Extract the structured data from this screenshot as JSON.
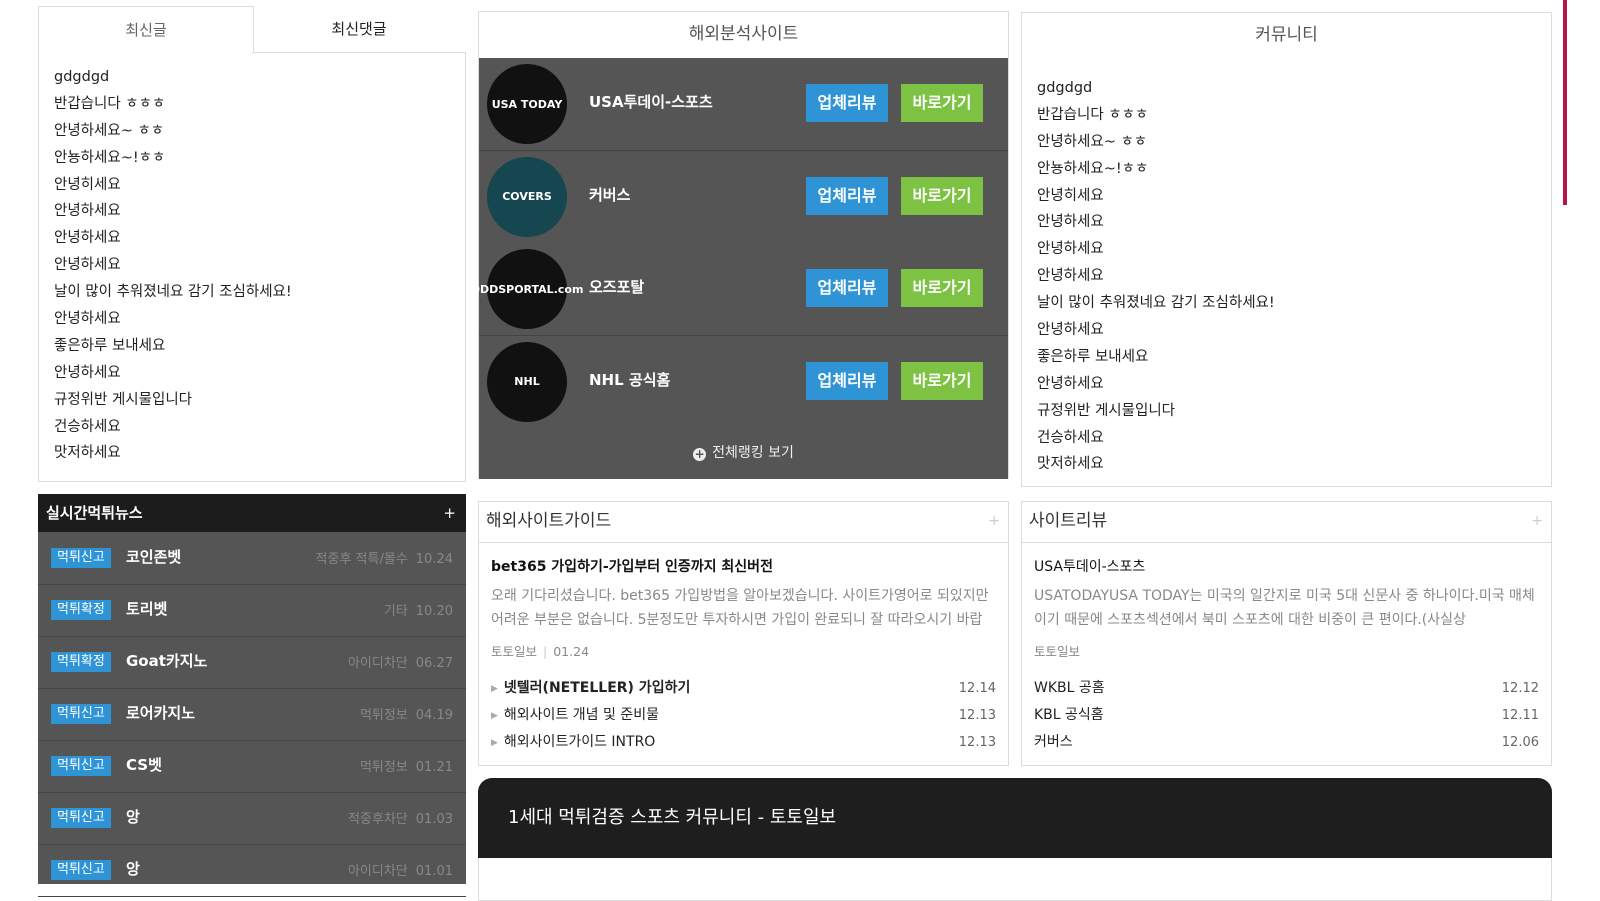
{
  "latest_tabs": {
    "tab_posts": "최신글",
    "tab_comments": "최신댓글"
  },
  "latest_posts": [
    "gdgdgd",
    "반갑습니다 ㅎㅎㅎ",
    "안녕하세요~ ㅎㅎ",
    "안뇽하세요~!ㅎㅎ",
    "안녕히세요",
    "안녕하세요",
    "안녕하세요",
    "안녕하세요",
    "날이 많이 추워졌네요 감기 조심하세요!",
    "안녕하세요",
    "좋은하루 보내세요",
    "안녕하세요",
    "규정위반 게시물입니다",
    "건승하세요",
    "맛저하세요"
  ],
  "analysis": {
    "title": "해외분석사이트",
    "sites": [
      {
        "name": "USA투데이-스포츠",
        "logo_text": "USA TODAY",
        "logo_color": "#111111",
        "review": "업체리뷰",
        "go": "바로가기"
      },
      {
        "name": "커버스",
        "logo_text": "COVERS",
        "logo_color": "#16464f",
        "review": "업체리뷰",
        "go": "바로가기"
      },
      {
        "name": "오즈포탈",
        "logo_text": "ODDSPORTAL.com",
        "logo_color": "#111111",
        "review": "업체리뷰",
        "go": "바로가기"
      },
      {
        "name": "NHL 공식홈",
        "logo_text": "NHL",
        "logo_color": "#111111",
        "review": "업체리뷰",
        "go": "바로가기"
      }
    ],
    "all_ranking": "전체랭킹 보기"
  },
  "community": {
    "title": "커뮤니티",
    "posts": [
      "gdgdgd",
      "반갑습니다 ㅎㅎㅎ",
      "안녕하세요~ ㅎㅎ",
      "안뇽하세요~!ㅎㅎ",
      "안녕히세요",
      "안녕하세요",
      "안녕하세요",
      "안녕하세요",
      "날이 많이 추워졌네요 감기 조심하세요!",
      "안녕하세요",
      "좋은하루 보내세요",
      "안녕하세요",
      "규정위반 게시물입니다",
      "건승하세요",
      "맛저하세요"
    ]
  },
  "news": {
    "title": "실시간먹튀뉴스",
    "plus": "+",
    "items": [
      {
        "badge": "먹튀신고",
        "title": "코인존벳",
        "category": "적중후 적특/몰수",
        "date": "10.24"
      },
      {
        "badge": "먹튀확정",
        "title": "토리벳",
        "category": "기타",
        "date": "10.20"
      },
      {
        "badge": "먹튀확정",
        "title": "Goat카지노",
        "category": "아이디차단",
        "date": "06.27"
      },
      {
        "badge": "먹튀신고",
        "title": "로어카지노",
        "category": "먹튀정보",
        "date": "04.19"
      },
      {
        "badge": "먹튀신고",
        "title": "CS벳",
        "category": "먹튀정보",
        "date": "01.21"
      },
      {
        "badge": "먹튀신고",
        "title": "앙",
        "category": "적중후차단",
        "date": "01.03"
      },
      {
        "badge": "먹튀신고",
        "title": "앙",
        "category": "아이디차단",
        "date": "01.01"
      }
    ]
  },
  "guide": {
    "title": "해외사이트가이드",
    "plus": "+",
    "featured_title": "bet365 가입하기-가입부터 인증까지 최신버전",
    "featured_excerpt": "오래 기다리셨습니다. bet365 가입방법을 알아보겠습니다. 사이트가영어로 되있지만 어려운 부분은 없습니다. 5분정도만 투자하시면 가입이 완료되니 잘 따라오시기 바랍",
    "featured_author": "토토일보",
    "featured_date": "01.24",
    "links": [
      {
        "title": "넷텔러(NETELLER) 가입하기",
        "date": "12.14",
        "bold": true
      },
      {
        "title": "해외사이트 개념 및 준비물",
        "date": "12.13",
        "bold": false
      },
      {
        "title": "해외사이트가이드 INTRO",
        "date": "12.13",
        "bold": false
      }
    ]
  },
  "review": {
    "title": "사이트리뷰",
    "plus": "+",
    "featured_title": "USA투데이-스포츠",
    "featured_excerpt": "USATODAYUSA TODAY는 미국의 일간지로 미국 5대 신문사 중 하나이다.미국 매체이기 때문에 스포츠섹션에서 북미 스포츠에 대한 비중이 큰 편이다.(사실상",
    "featured_author": "토토일보",
    "links": [
      {
        "title": "WKBL 공홈",
        "date": "12.12"
      },
      {
        "title": "KBL 공식홈",
        "date": "12.11"
      },
      {
        "title": "커버스",
        "date": "12.06"
      }
    ]
  },
  "banner": {
    "text": "1세대 먹튀검증 스포츠 커뮤니티 - 토토일보"
  },
  "colors": {
    "review_button": "#2f94d6",
    "go_button": "#7dc242",
    "panel_dark": "#555555",
    "header_dark": "#1c1c1c",
    "accent_edge": "#b5154d"
  }
}
